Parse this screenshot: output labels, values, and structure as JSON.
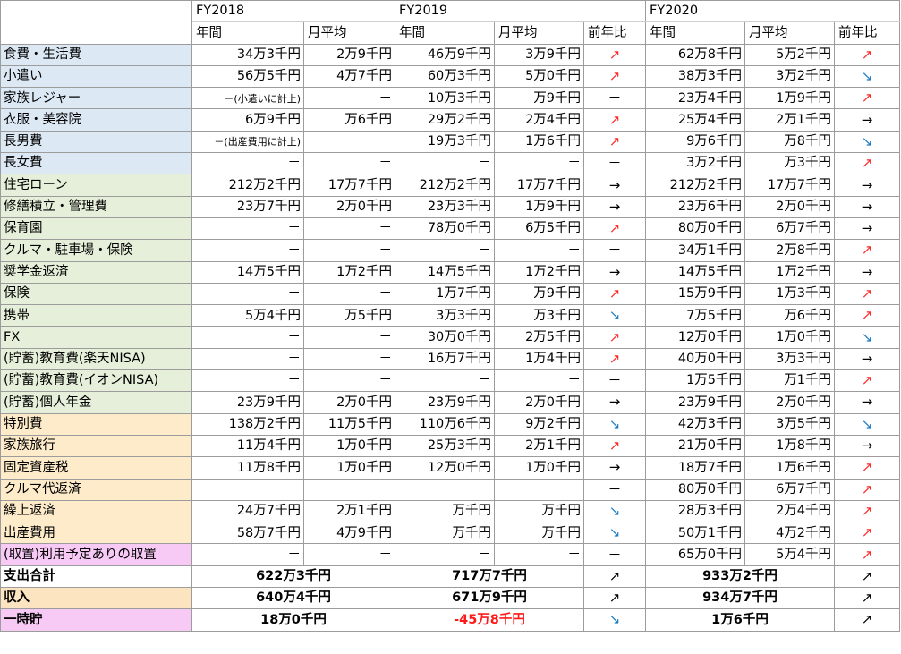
{
  "colors": {
    "daily": "#dde8f5",
    "fixed": "#e5efd9",
    "special": "#fdebc9",
    "reserve": "#f7c9f5",
    "income": "#fde4c0",
    "savings": "#f7c9f5",
    "arrow_up": "#ff2a2a",
    "arrow_down": "#1f7dc4"
  },
  "header": {
    "years": [
      "FY2018",
      "FY2019",
      "FY2020"
    ],
    "col_annual": "年間",
    "col_monthly": "月平均",
    "col_yoy": "前年比"
  },
  "rows": [
    {
      "label": "食費・生活費",
      "group": "daily",
      "cells": [
        "34万3千円",
        "2万9千円",
        "46万9千円",
        "3万9千円",
        "up",
        "62万8千円",
        "5万2千円",
        "up"
      ]
    },
    {
      "label": "小遣い",
      "group": "daily",
      "cells": [
        "56万5千円",
        "4万7千円",
        "60万3千円",
        "5万0千円",
        "up",
        "38万3千円",
        "3万2千円",
        "down"
      ]
    },
    {
      "label": "家族レジャー",
      "group": "daily",
      "cells": [
        "－(小遣いに計上)",
        "－",
        "10万3千円",
        "万9千円",
        "－",
        "23万4千円",
        "1万9千円",
        "up"
      ]
    },
    {
      "label": "衣服・美容院",
      "group": "daily",
      "cells": [
        "6万9千円",
        "万6千円",
        "29万2千円",
        "2万4千円",
        "up",
        "25万4千円",
        "2万1千円",
        "flat"
      ]
    },
    {
      "label": "長男費",
      "group": "daily",
      "cells": [
        "－(出産費用に計上)",
        "－",
        "19万3千円",
        "1万6千円",
        "up",
        "9万6千円",
        "万8千円",
        "down"
      ]
    },
    {
      "label": "長女費",
      "group": "daily",
      "cells": [
        "－",
        "－",
        "－",
        "－",
        "－",
        "3万2千円",
        "万3千円",
        "up"
      ]
    },
    {
      "label": "住宅ローン",
      "group": "fixed",
      "cells": [
        "212万2千円",
        "17万7千円",
        "212万2千円",
        "17万7千円",
        "flat",
        "212万2千円",
        "17万7千円",
        "flat"
      ]
    },
    {
      "label": "修繕積立・管理費",
      "group": "fixed",
      "cells": [
        "23万7千円",
        "2万0千円",
        "23万3千円",
        "1万9千円",
        "flat",
        "23万6千円",
        "2万0千円",
        "flat"
      ]
    },
    {
      "label": "保育園",
      "group": "fixed",
      "cells": [
        "－",
        "－",
        "78万0千円",
        "6万5千円",
        "up",
        "80万0千円",
        "6万7千円",
        "flat"
      ]
    },
    {
      "label": "クルマ・駐車場・保険",
      "group": "fixed",
      "cells": [
        "－",
        "－",
        "－",
        "－",
        "－",
        "34万1千円",
        "2万8千円",
        "up"
      ]
    },
    {
      "label": "奨学金返済",
      "group": "fixed",
      "cells": [
        "14万5千円",
        "1万2千円",
        "14万5千円",
        "1万2千円",
        "flat",
        "14万5千円",
        "1万2千円",
        "flat"
      ]
    },
    {
      "label": "保険",
      "group": "fixed",
      "cells": [
        "－",
        "－",
        "1万7千円",
        "万9千円",
        "up",
        "15万9千円",
        "1万3千円",
        "up"
      ]
    },
    {
      "label": "携帯",
      "group": "fixed",
      "cells": [
        "5万4千円",
        "万5千円",
        "3万3千円",
        "万3千円",
        "down",
        "7万5千円",
        "万6千円",
        "up"
      ]
    },
    {
      "label": "FX",
      "group": "fixed",
      "cells": [
        "－",
        "－",
        "30万0千円",
        "2万5千円",
        "up",
        "12万0千円",
        "1万0千円",
        "down"
      ]
    },
    {
      "label": "(貯蓄)教育費(楽天NISA)",
      "group": "fixed",
      "cells": [
        "－",
        "－",
        "16万7千円",
        "1万4千円",
        "up",
        "40万0千円",
        "3万3千円",
        "flat"
      ]
    },
    {
      "label": "(貯蓄)教育費(イオンNISA)",
      "group": "fixed",
      "cells": [
        "－",
        "－",
        "－",
        "－",
        "－",
        "1万5千円",
        "万1千円",
        "up"
      ]
    },
    {
      "label": "(貯蓄)個人年金",
      "group": "fixed",
      "cells": [
        "23万9千円",
        "2万0千円",
        "23万9千円",
        "2万0千円",
        "flat",
        "23万9千円",
        "2万0千円",
        "flat"
      ]
    },
    {
      "label": "特別費",
      "group": "special",
      "cells": [
        "138万2千円",
        "11万5千円",
        "110万6千円",
        "9万2千円",
        "down",
        "42万3千円",
        "3万5千円",
        "down"
      ]
    },
    {
      "label": "家族旅行",
      "group": "special",
      "cells": [
        "11万4千円",
        "1万0千円",
        "25万3千円",
        "2万1千円",
        "up",
        "21万0千円",
        "1万8千円",
        "flat"
      ]
    },
    {
      "label": "固定資産税",
      "group": "special",
      "cells": [
        "11万8千円",
        "1万0千円",
        "12万0千円",
        "1万0千円",
        "flat",
        "18万7千円",
        "1万6千円",
        "up"
      ]
    },
    {
      "label": "クルマ代返済",
      "group": "special",
      "cells": [
        "－",
        "－",
        "－",
        "－",
        "－",
        "80万0千円",
        "6万7千円",
        "up"
      ]
    },
    {
      "label": "繰上返済",
      "group": "special",
      "cells": [
        "24万7千円",
        "2万1千円",
        "万千円",
        "万千円",
        "down",
        "28万3千円",
        "2万4千円",
        "up"
      ]
    },
    {
      "label": "出産費用",
      "group": "special",
      "cells": [
        "58万7千円",
        "4万9千円",
        "万千円",
        "万千円",
        "down",
        "50万1千円",
        "4万2千円",
        "up"
      ]
    },
    {
      "label": "(取置)利用予定ありの取置",
      "group": "reserve",
      "cells": [
        "－",
        "－",
        "－",
        "－",
        "－",
        "65万0千円",
        "5万4千円",
        "up"
      ]
    }
  ],
  "totals": [
    {
      "label": "支出合計",
      "group": "none",
      "fy2018": "622万3千円",
      "fy2019": "717万7千円",
      "yoy2019": "↗",
      "fy2020": "933万2千円",
      "yoy2020": "↗"
    },
    {
      "label": "収入",
      "group": "income",
      "fy2018": "640万4千円",
      "fy2019": "671万9千円",
      "yoy2019": "↗",
      "fy2020": "934万7千円",
      "yoy2020": "↗"
    },
    {
      "label": "一時貯",
      "group": "savings",
      "fy2018": "18万0千円",
      "fy2019": "-45万8千円",
      "yoy2019": "↘",
      "fy2020": "1万6千円",
      "yoy2020": "↗"
    }
  ],
  "arrows": {
    "up": "↗",
    "down": "↘",
    "flat": "→",
    "none": "－"
  }
}
